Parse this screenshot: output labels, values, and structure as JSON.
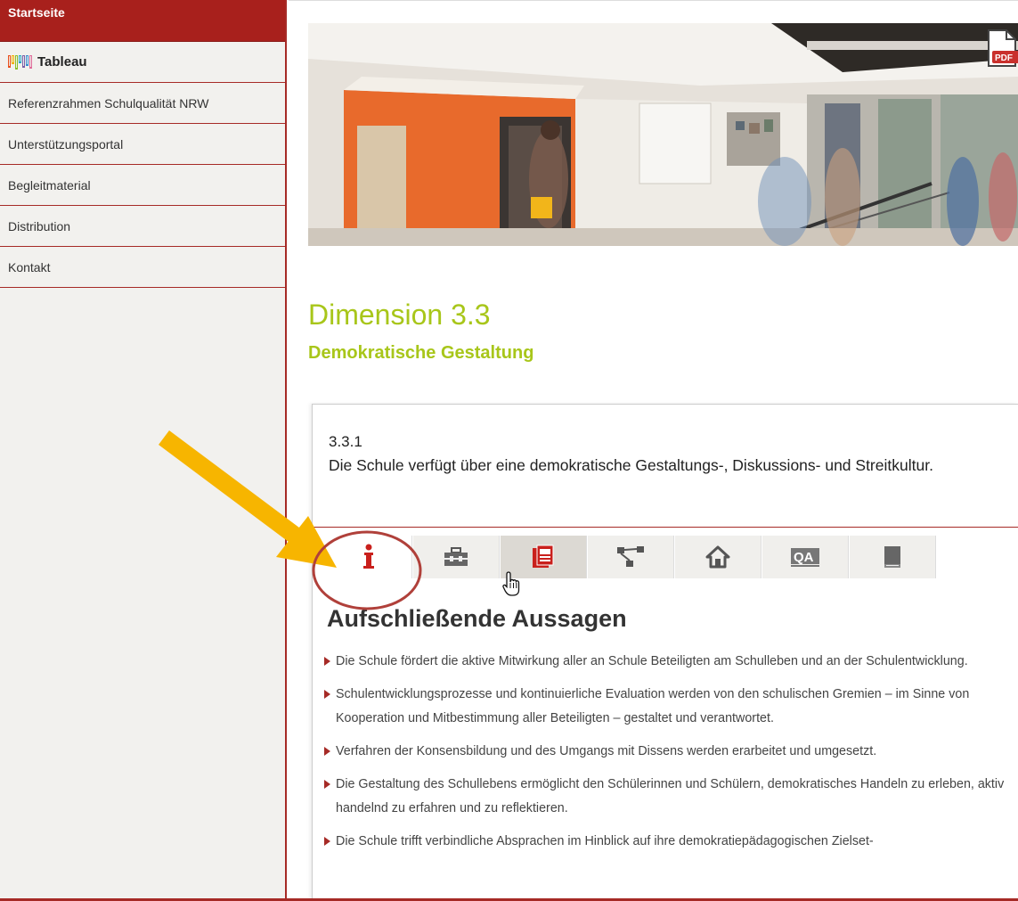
{
  "sidebar": {
    "items": [
      {
        "label": "Startseite"
      },
      {
        "label": "Tableau"
      },
      {
        "label": "Referenzrahmen Schulqualität NRW"
      },
      {
        "label": "Unterstützungsportal"
      },
      {
        "label": "Begleitmaterial"
      },
      {
        "label": "Distribution"
      },
      {
        "label": "Kontakt"
      }
    ]
  },
  "header": {
    "pdf_label": "PDF"
  },
  "dimension": {
    "title": "Dimension 3.3",
    "subtitle": "Demokratische Gestaltung"
  },
  "criterion": {
    "number": "3.3.1",
    "text": "Die Schule verfügt über eine demokratische Gestaltungs-, Diskussions- und Streitkultur."
  },
  "tabs": [
    {
      "icon": "info-icon",
      "active": true
    },
    {
      "icon": "toolbox-icon"
    },
    {
      "icon": "document-icon",
      "hover": true
    },
    {
      "icon": "network-icon"
    },
    {
      "icon": "home-icon"
    },
    {
      "icon": "qa-icon",
      "text": "QA"
    },
    {
      "icon": "book-icon"
    }
  ],
  "section": {
    "title": "Aufschließende Aussagen",
    "items": [
      "Die Schule fördert die aktive Mitwirkung aller an Schule Beteiligten am Schulleben und an der Schulentwicklung.",
      "Schulentwicklungsprozesse und kontinuierliche Evaluation werden von den schulischen Gremien – im Sinne von Kooperation und Mitbestimmung aller Beteiligten – gestaltet und verantwortet.",
      "Verfahren der Konsensbildung und des Umgangs mit Dissens werden erarbeitet und umgesetzt.",
      "Die Gestaltung des Schullebens ermöglicht den Schülerinnen und Schülern, demokratisches Handeln zu erleben, aktiv handelnd zu erfahren und zu reflektieren.",
      "Die Schule trifft verbindliche Absprachen im Hinblick auf ihre demokratiepädagogischen Zielset-"
    ]
  },
  "colors": {
    "brand_red": "#a8201c",
    "accent_green": "#a8c61a",
    "annotation_arrow": "#f7b500",
    "annotation_circle": "#b0403a"
  }
}
